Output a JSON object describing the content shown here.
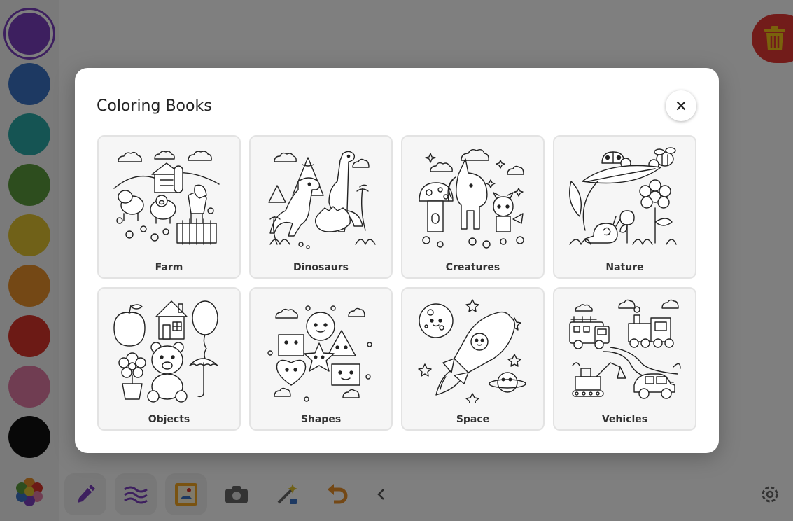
{
  "palette": {
    "colors": [
      {
        "name": "purple",
        "hex": "#7a3fbf",
        "selected": true
      },
      {
        "name": "blue",
        "hex": "#3b73c4"
      },
      {
        "name": "teal",
        "hex": "#2aa8a6"
      },
      {
        "name": "green",
        "hex": "#5a9a3c"
      },
      {
        "name": "yellow",
        "hex": "#e0c230"
      },
      {
        "name": "orange",
        "hex": "#e8902a"
      },
      {
        "name": "red",
        "hex": "#d8342a"
      },
      {
        "name": "pink",
        "hex": "#e07ba4"
      },
      {
        "name": "black",
        "hex": "#111111"
      }
    ]
  },
  "toolbar": {
    "tools": [
      "pen-icon",
      "wave-brush-icon",
      "coloring-book-icon",
      "camera-icon",
      "magic-wand-icon",
      "undo-icon",
      "chevron-left-icon",
      "settings-icon"
    ]
  },
  "modal": {
    "title": "Coloring Books",
    "close_icon": "close-icon"
  },
  "books": [
    {
      "label": "Farm"
    },
    {
      "label": "Dinosaurs"
    },
    {
      "label": "Creatures"
    },
    {
      "label": "Nature"
    },
    {
      "label": "Objects"
    },
    {
      "label": "Shapes"
    },
    {
      "label": "Space"
    },
    {
      "label": "Vehicles"
    }
  ]
}
